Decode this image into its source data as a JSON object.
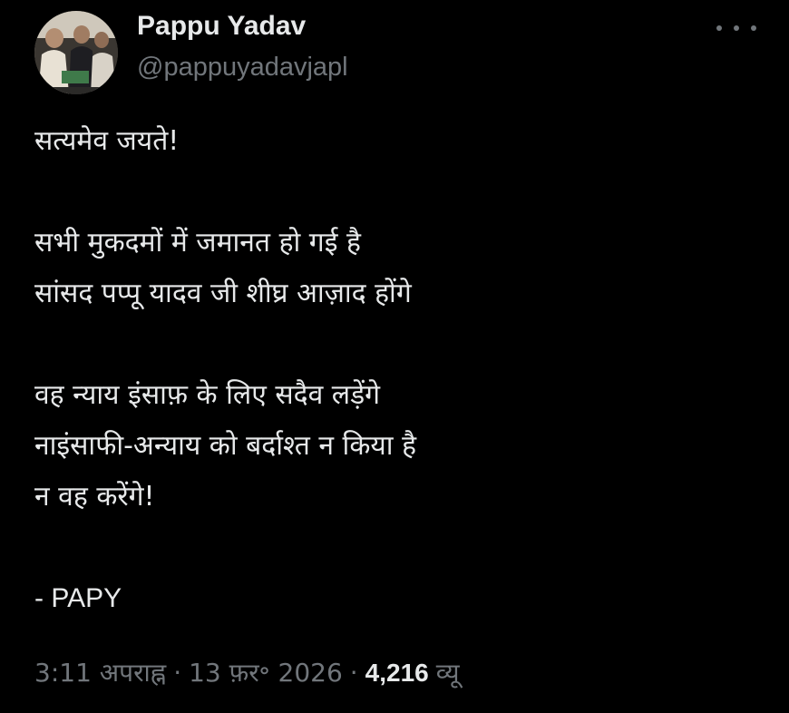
{
  "author": {
    "name": "Pappu Yadav",
    "handle": "@pappuyadavjapl"
  },
  "icons": {
    "more": "more-horizontal-icon",
    "avatar": "profile-photo"
  },
  "tweet": {
    "lines": [
      "सत्यमेव जयते!",
      "",
      "सभी मुकदमों में जमानत हो गई है",
      "सांसद पप्पू यादव जी शीघ्र आज़ाद होंगे",
      "",
      "वह न्याय इंसाफ़ के लिए सदैव लड़ेंगे",
      "नाइंसाफी-अन्याय को बर्दाश्त न किया है",
      "न वह करेंगे!",
      "",
      "- PAPY"
    ]
  },
  "meta": {
    "time": "3:11 अपराह्न",
    "separator": "·",
    "date": "13 फ़र॰ 2026",
    "views_count": "4,216",
    "views_label": "व्यू"
  },
  "colors": {
    "background": "#000000",
    "text_primary": "#e7e9ea",
    "text_secondary": "#71767b"
  }
}
